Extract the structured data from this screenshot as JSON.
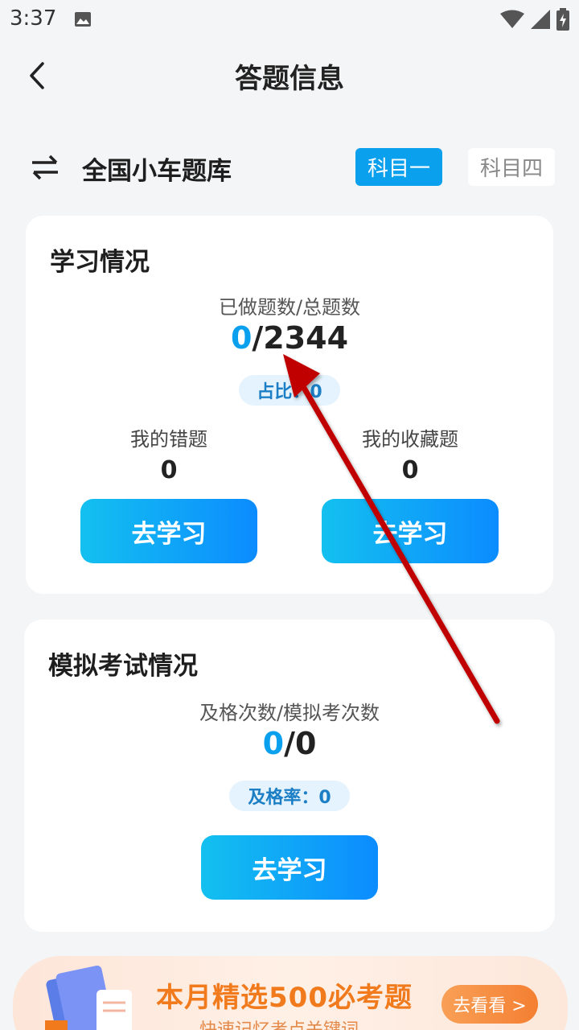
{
  "status_bar": {
    "time": "3:37"
  },
  "header": {
    "title": "答题信息"
  },
  "bank": {
    "name": "全国小车题库",
    "tabs": [
      {
        "label": "科目一",
        "selected": true
      },
      {
        "label": "科目四",
        "selected": false
      }
    ]
  },
  "study": {
    "title": "学习情况",
    "progress_label": "已做题数/总题数",
    "done": "0",
    "total_sep": "/2344",
    "ratio_label": "占比：0",
    "wrong": {
      "label": "我的错题",
      "value": "0",
      "button": "去学习"
    },
    "favorites": {
      "label": "我的收藏题",
      "value": "0",
      "button": "去学习"
    }
  },
  "exam": {
    "title": "模拟考试情况",
    "progress_label": "及格次数/模拟考次数",
    "passed": "0",
    "total_sep": "/0",
    "rate_label": "及格率：0",
    "button": "去学习"
  },
  "banner": {
    "title": "本月精选500必考题",
    "subtitle": "快速记忆考点关键词",
    "button": "去看看 >"
  },
  "colors": {
    "accent": "#0aa0ee",
    "annotation_arrow": "#c00000"
  }
}
